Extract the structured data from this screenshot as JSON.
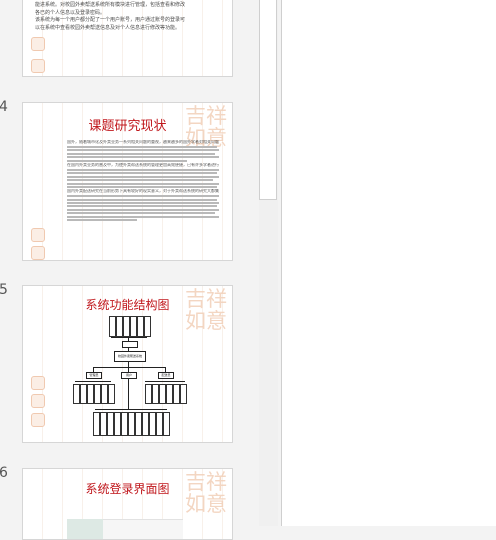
{
  "thumbnails": [
    {
      "number": "",
      "text_lines": [
        "能进系统。对校园外卖帮送系统所有模块进行管理，包括查看和修改",
        "各已的个人信息以及登录密码。",
        "该系统为每一个用户都分配了一个用户账号，用户通过账号的登录可",
        "以在系统中查看校园外卖帮送信息及对个人信息进行修改等功能。"
      ]
    },
    {
      "number": "4",
      "title": "课题研究现状",
      "watermark": "吉祥如意",
      "bullets": [
        "国外，随着城市化及外卖业务一系列相关问题的重视，越来越多的国外学者对相关问题展开研究，",
        "在国内外卖业务的普及中，为使外卖帮送系统的管理更加高效便捷，已有许多学者进行研究，",
        "国内外卖配送研究在当前形势下具有较好的现实意义，对于外卖帮送系统的研究大都集中于……"
      ]
    },
    {
      "number": "5",
      "title": "系统功能结构图",
      "watermark": "吉祥如意"
    },
    {
      "number": "6",
      "title": "系统登录界面图",
      "watermark": "吉祥如意"
    }
  ],
  "diagram_labels": {
    "root": "校园外卖帮送系统",
    "branch_left": "管理员",
    "branch_mid": "用户",
    "branch_right": "配送员"
  }
}
